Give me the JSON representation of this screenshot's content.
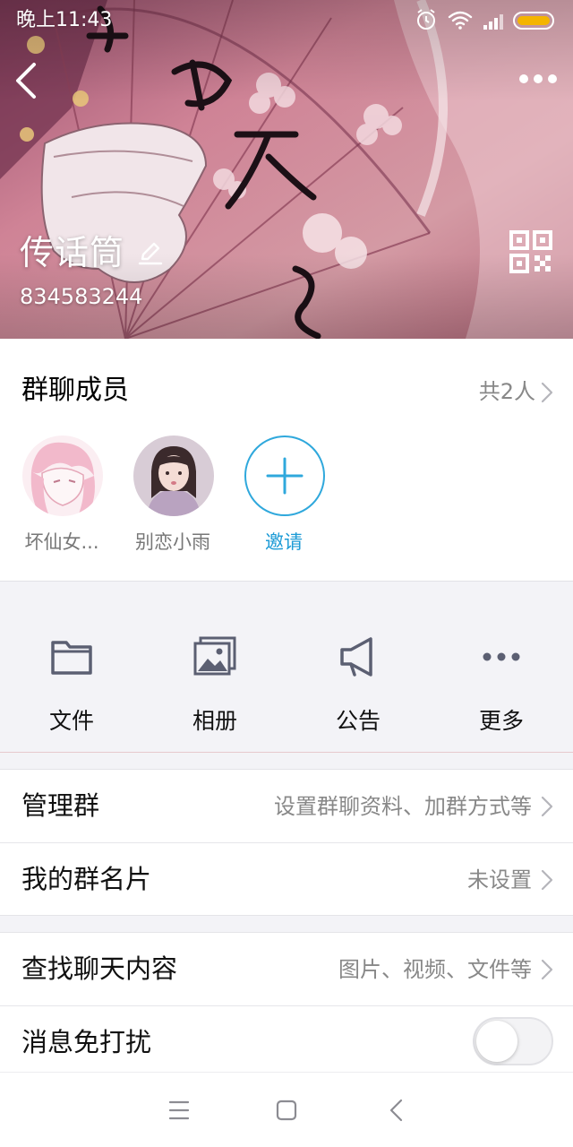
{
  "status_bar": {
    "time": "晚上11:43",
    "icons": [
      "alarm-icon",
      "wifi-icon",
      "signal-icon",
      "battery-icon"
    ]
  },
  "header": {
    "group_name": "传话筒",
    "group_id": "834583244"
  },
  "members": {
    "title": "群聊成员",
    "count": "共2人",
    "list": [
      {
        "name": "坏仙女..."
      },
      {
        "name": "别恋小雨"
      }
    ],
    "invite_label": "邀请"
  },
  "functions": [
    {
      "label": "文件",
      "icon": "folder-icon"
    },
    {
      "label": "相册",
      "icon": "album-icon"
    },
    {
      "label": "公告",
      "icon": "announcement-icon"
    },
    {
      "label": "更多",
      "icon": "more-dots-icon"
    }
  ],
  "settings": {
    "manage": {
      "title": "管理群",
      "value": "设置群聊资料、加群方式等"
    },
    "card": {
      "title": "我的群名片",
      "value": "未设置"
    },
    "search": {
      "title": "查找聊天内容",
      "value": "图片、视频、文件等"
    },
    "mute": {
      "title": "消息免打扰",
      "enabled": false
    }
  },
  "colors": {
    "accent": "#1d9bd6",
    "icon_gray": "#5b5f72",
    "banner": "#c47989"
  }
}
